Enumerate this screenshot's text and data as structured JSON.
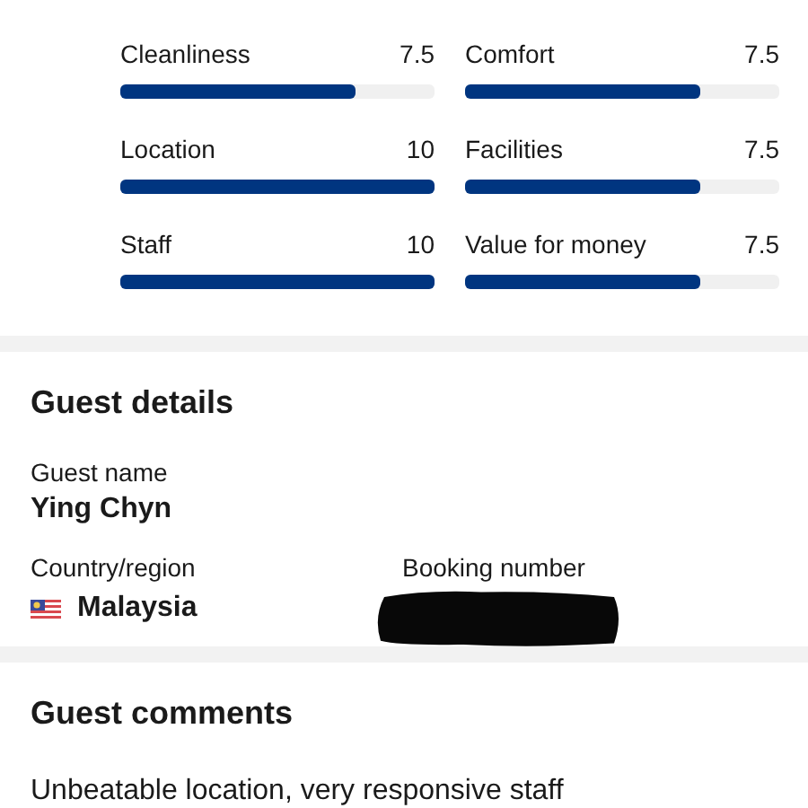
{
  "ratings": [
    {
      "label": "Cleanliness",
      "score": "7.5",
      "level": 0.75
    },
    {
      "label": "Comfort",
      "score": "7.5",
      "level": 0.75
    },
    {
      "label": "Location",
      "score": "10",
      "level": 1
    },
    {
      "label": "Facilities",
      "score": "7.5",
      "level": 0.75
    },
    {
      "label": "Staff",
      "score": "10",
      "level": 1
    },
    {
      "label": "Value for money",
      "score": "7.5",
      "level": 0.75
    }
  ],
  "guest_details": {
    "title": "Guest details",
    "guest_name_label": "Guest name",
    "guest_name": "Ying Chyn",
    "country_label": "Country/region",
    "country": "Malaysia",
    "booking_number_label": "Booking number"
  },
  "guest_comments": {
    "title": "Guest comments",
    "comment": "Unbeatable location, very responsive staff"
  }
}
